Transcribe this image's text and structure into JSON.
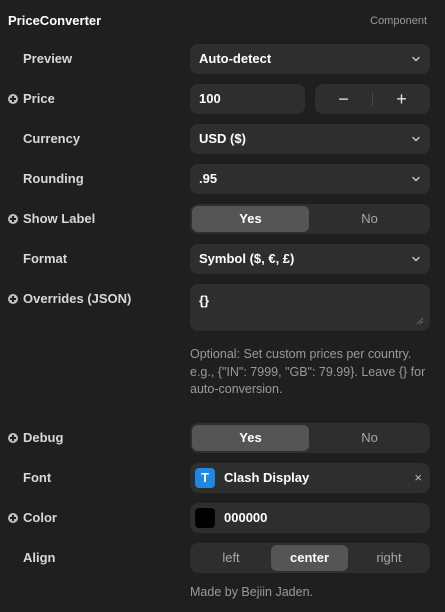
{
  "header": {
    "title": "PriceConverter",
    "tag": "Component"
  },
  "preview": {
    "label": "Preview",
    "value": "Auto-detect"
  },
  "price": {
    "label": "Price",
    "value": "100",
    "minus": "−",
    "plus": "+"
  },
  "currency": {
    "label": "Currency",
    "value": "USD ($)"
  },
  "rounding": {
    "label": "Rounding",
    "value": ".95"
  },
  "show_label": {
    "label": "Show Label",
    "options": [
      "Yes",
      "No"
    ],
    "selected": "Yes"
  },
  "format": {
    "label": "Format",
    "value": "Symbol ($, €, £)"
  },
  "overrides": {
    "label": "Overrides (JSON)",
    "value": "{}",
    "help": "Optional: Set custom prices per country. e.g., {\"IN\": 7999, \"GB\": 79.99}. Leave {} for auto-conversion."
  },
  "debug": {
    "label": "Debug",
    "options": [
      "Yes",
      "No"
    ],
    "selected": "Yes"
  },
  "font": {
    "label": "Font",
    "badge": "T",
    "value": "Clash Display",
    "clear": "×"
  },
  "color": {
    "label": "Color",
    "value": "000000",
    "swatch": "#000000"
  },
  "align": {
    "label": "Align",
    "options": [
      "left",
      "center",
      "right"
    ],
    "selected": "center"
  },
  "footer": {
    "text": "Made by Bejiin Jaden."
  }
}
